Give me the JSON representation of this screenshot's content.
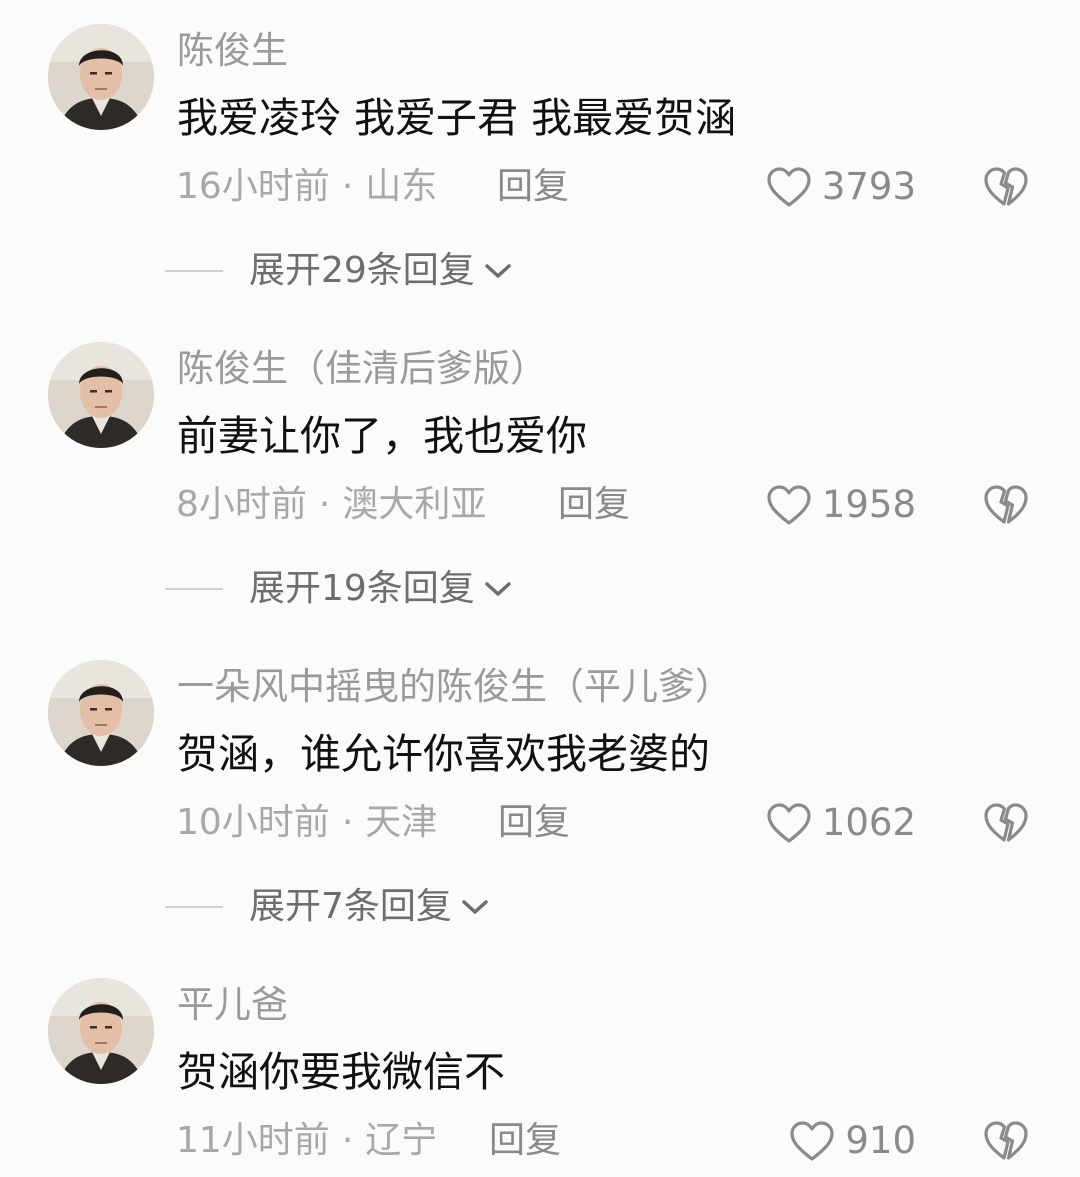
{
  "colors": {
    "background": "#fbfbfa",
    "username": "#9a9a9a",
    "content": "#111111",
    "meta": "#a8a8a8",
    "icon": "#8a8a8a"
  },
  "comments": [
    {
      "username": "陈俊生",
      "content": "我爱凌玲 我爱子君 我最爱贺涵",
      "time": "16小时前",
      "location": "山东",
      "reply_label": "回复",
      "likes": "3793",
      "expand_label": "展开29条回复"
    },
    {
      "username": "陈俊生（佳清后爹版）",
      "content": "前妻让你了，我也爱你",
      "time": "8小时前",
      "location": "澳大利亚",
      "reply_label": "回复",
      "likes": "1958",
      "expand_label": "展开19条回复"
    },
    {
      "username": "一朵风中摇曳的陈俊生（平儿爹）",
      "content": "贺涵，谁允许你喜欢我老婆的",
      "time": "10小时前",
      "location": "天津",
      "reply_label": "回复",
      "likes": "1062",
      "expand_label": "展开7条回复"
    },
    {
      "username": "平儿爸",
      "content": "贺涵你要我微信不",
      "time": "11小时前",
      "location": "辽宁",
      "reply_label": "回复",
      "likes": "910"
    }
  ]
}
